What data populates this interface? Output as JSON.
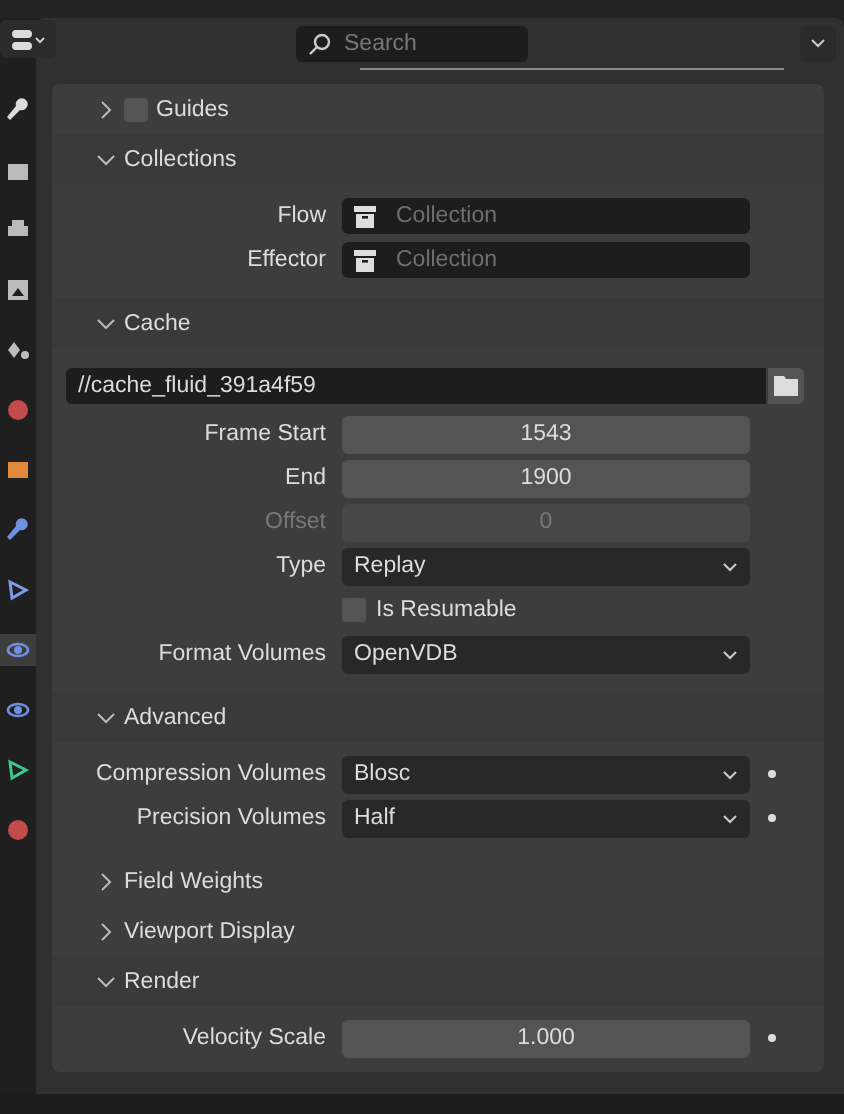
{
  "header": {
    "search": {
      "placeholder": "Search"
    }
  },
  "tabs": [
    {
      "kind": "wrench",
      "color": "#dddddd",
      "selected": false
    },
    {
      "kind": "camera",
      "color": "#bbbbbb",
      "selected": false
    },
    {
      "kind": "printer",
      "color": "#bbbbbb",
      "selected": false
    },
    {
      "kind": "image",
      "color": "#bbbbbb",
      "selected": false
    },
    {
      "kind": "shapes",
      "color": "#bbbbbb",
      "selected": false
    },
    {
      "kind": "globe",
      "color": "#c24b4b",
      "selected": false
    },
    {
      "kind": "square",
      "color": "#e08a3a",
      "selected": false
    },
    {
      "kind": "wrench",
      "color": "#6f8fe0",
      "selected": false
    },
    {
      "kind": "nodes",
      "color": "#7a9be6",
      "selected": false
    },
    {
      "kind": "orbit",
      "color": "#6f8fe0",
      "selected": true
    },
    {
      "kind": "orbit",
      "color": "#6f8fe0",
      "selected": false
    },
    {
      "kind": "nodes",
      "color": "#3fc48a",
      "selected": false
    },
    {
      "kind": "globe",
      "color": "#c24b4b",
      "selected": false
    }
  ],
  "rows": [
    {
      "kind": "subpanel",
      "label": "Guides",
      "expanded": false,
      "checked": false
    },
    {
      "kind": "subpanel",
      "label": "Collections",
      "expanded": true
    },
    {
      "kind": "collection",
      "label": "Flow",
      "placeholder": "Collection"
    },
    {
      "kind": "collection",
      "label": "Effector",
      "placeholder": "Collection"
    },
    {
      "kind": "subpanel",
      "label": "Cache",
      "expanded": true
    },
    {
      "kind": "path",
      "value": "//cache_fluid_391a4f59"
    },
    {
      "kind": "number",
      "label": "Frame Start",
      "value": "1543",
      "disabled": false,
      "keyframe": false
    },
    {
      "kind": "number",
      "label": "End",
      "value": "1900",
      "disabled": false,
      "keyframe": false
    },
    {
      "kind": "number",
      "label": "Offset",
      "value": "0",
      "disabled": true,
      "keyframe": false
    },
    {
      "kind": "dropdown",
      "label": "Type",
      "value": "Replay",
      "keyframe": false
    },
    {
      "kind": "checkbox",
      "label": "Is Resumable",
      "checked": false
    },
    {
      "kind": "dropdown",
      "label": "Format Volumes",
      "value": "OpenVDB",
      "keyframe": false
    },
    {
      "kind": "subpanel",
      "label": "Advanced",
      "expanded": true
    },
    {
      "kind": "dropdown",
      "label": "Compression Volumes",
      "value": "Blosc",
      "keyframe": true
    },
    {
      "kind": "dropdown",
      "label": "Precision Volumes",
      "value": "Half",
      "keyframe": true
    },
    {
      "kind": "subpanel",
      "label": "Field Weights",
      "expanded": false
    },
    {
      "kind": "subpanel",
      "label": "Viewport Display",
      "expanded": false
    },
    {
      "kind": "subpanel",
      "label": "Render",
      "expanded": true
    },
    {
      "kind": "number",
      "label": "Velocity Scale",
      "value": "1.000",
      "disabled": false,
      "keyframe": true
    }
  ]
}
